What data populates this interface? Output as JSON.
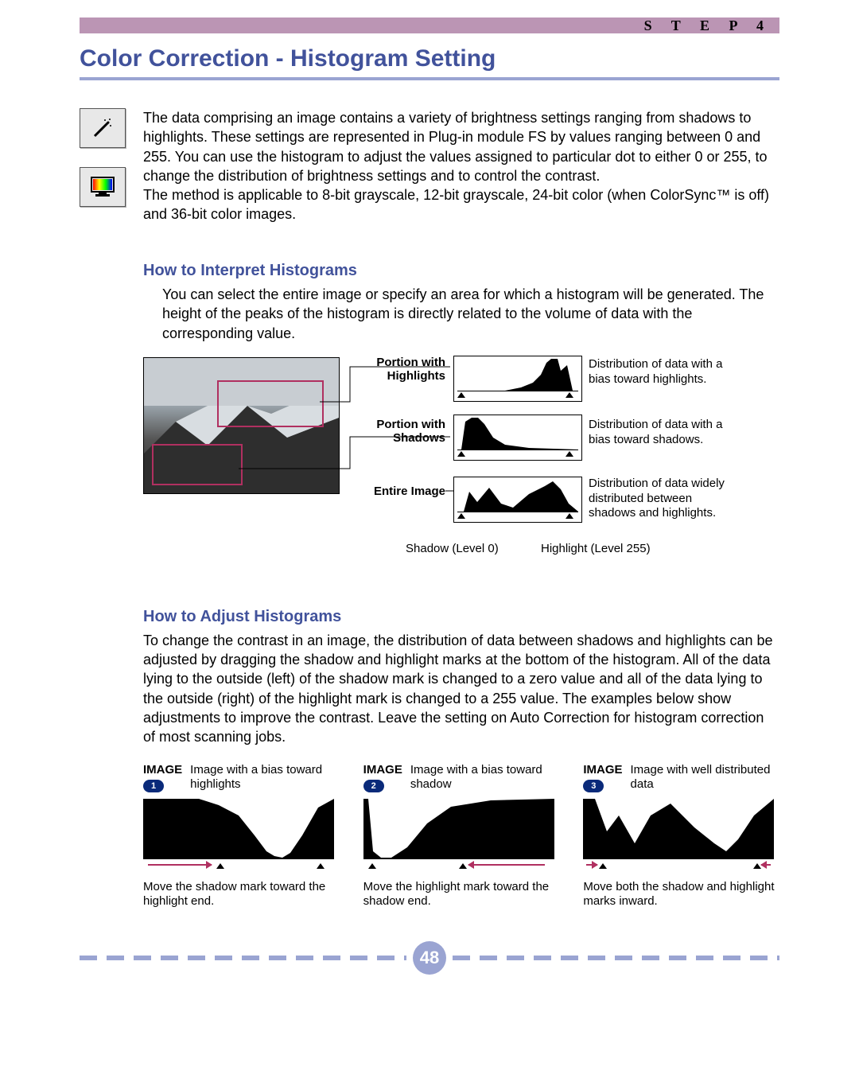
{
  "header": {
    "step_label": "S T E P   4",
    "title": "Color Correction - Histogram Setting"
  },
  "intro": {
    "p1": "The data comprising an image contains a variety of brightness settings ranging from shadows to highlights. These settings are represented in Plug-in module FS by values ranging between 0 and 255. You can use the histogram to adjust the values assigned to particular dot to either 0 or 255, to change the distribution of brightness settings and to control the contrast.",
    "p2": "The method is applicable to 8-bit grayscale, 12-bit grayscale, 24-bit color (when ColorSync™ is off) and 36-bit color images."
  },
  "interpret": {
    "heading": "How to Interpret Histograms",
    "body": "You can select the entire image or specify an area for which a histogram will be generated. The height of the peaks of the histogram is directly related to the volume of data with the corresponding value.",
    "rows": [
      {
        "label": "Portion with Highlights",
        "desc": "Distribution of data with a bias toward highlights."
      },
      {
        "label": "Portion with Shadows",
        "desc": "Distribution of data with a bias toward shadows."
      },
      {
        "label": "Entire Image",
        "desc": "Distribution of data widely distributed between shadows and highlights."
      }
    ],
    "shadow_axis": "Shadow (Level 0)",
    "highlight_axis": "Highlight (Level 255)"
  },
  "adjust": {
    "heading": "How to Adjust Histograms",
    "body": "To change the contrast in an image, the distribution of data between shadows and highlights can be adjusted by dragging the shadow and highlight marks at the bottom of the histogram. All of the data lying to the outside (left) of the shadow mark is changed to a zero value and all of the data lying to the outside (right) of the highlight mark is changed to a 255 value. The examples below show adjustments to improve the contrast. Leave the setting on Auto Correction for histogram correction of most scanning jobs.",
    "cols": [
      {
        "label": "IMAGE",
        "num": "1",
        "caption": "Image with a bias toward highlights",
        "instr": "Move the shadow mark toward the highlight end."
      },
      {
        "label": "IMAGE",
        "num": "2",
        "caption": "Image with a bias toward shadow",
        "instr": "Move the highlight mark toward the shadow end."
      },
      {
        "label": "IMAGE",
        "num": "3",
        "caption": "Image with well distributed data",
        "instr": "Move both the shadow and highlight marks inward."
      }
    ]
  },
  "page_number": "48"
}
